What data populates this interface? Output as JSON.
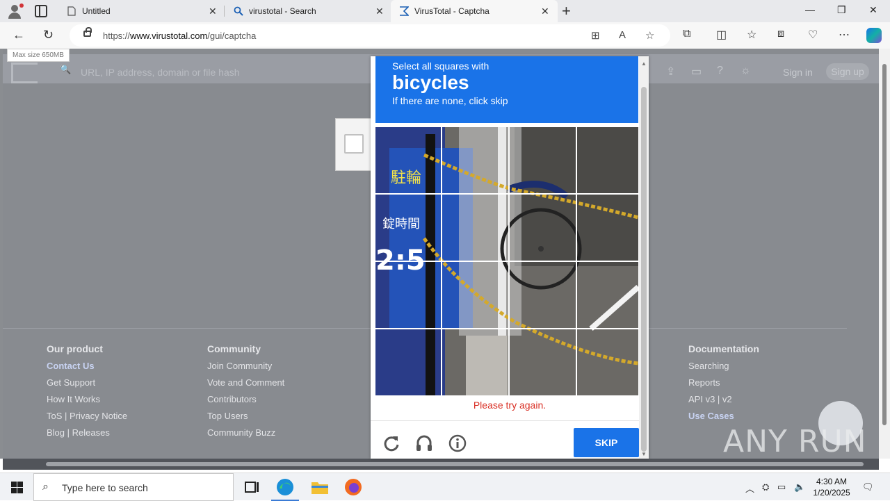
{
  "browser": {
    "tabs": [
      {
        "title": "Untitled",
        "icon": "page-icon",
        "active": false
      },
      {
        "title": "virustotal - Search",
        "icon": "search-icon",
        "active": false
      },
      {
        "title": "VirusTotal - Captcha",
        "icon": "virustotal-icon",
        "active": true
      }
    ],
    "url_prefix": "https://",
    "url_domain": "www.virustotal.com",
    "url_path": "/gui/captcha"
  },
  "vt_page": {
    "max_size": "Max size 650MB",
    "search_placeholder": "URL, IP address, domain or file hash",
    "sign_in": "Sign in",
    "sign_up": "Sign up",
    "footer": {
      "our_product": {
        "heading": "Our product",
        "items": [
          "Contact Us",
          "Get Support",
          "How It Works",
          "ToS | Privacy Notice",
          "Blog | Releases"
        ]
      },
      "community": {
        "heading": "Community",
        "items": [
          "Join Community",
          "Vote and Comment",
          "Contributors",
          "Top Users",
          "Community Buzz"
        ]
      },
      "documentation": {
        "heading": "Documentation",
        "items": [
          "Searching",
          "Reports",
          "API v3 | v2",
          "Use Cases"
        ]
      }
    }
  },
  "captcha": {
    "instruction_line1": "Select all squares with",
    "target_word": "bicycles",
    "instruction_line2": "If there are none, click skip",
    "error_text": "Please try again.",
    "skip_label": "SKIP",
    "grid_rows": 4,
    "grid_cols": 4,
    "accent_color": "#1a73e8",
    "error_color": "#d93025"
  },
  "watermark": "ANY RUN",
  "taskbar": {
    "search_placeholder": "Type here to search",
    "time": "4:30 AM",
    "date": "1/20/2025"
  }
}
